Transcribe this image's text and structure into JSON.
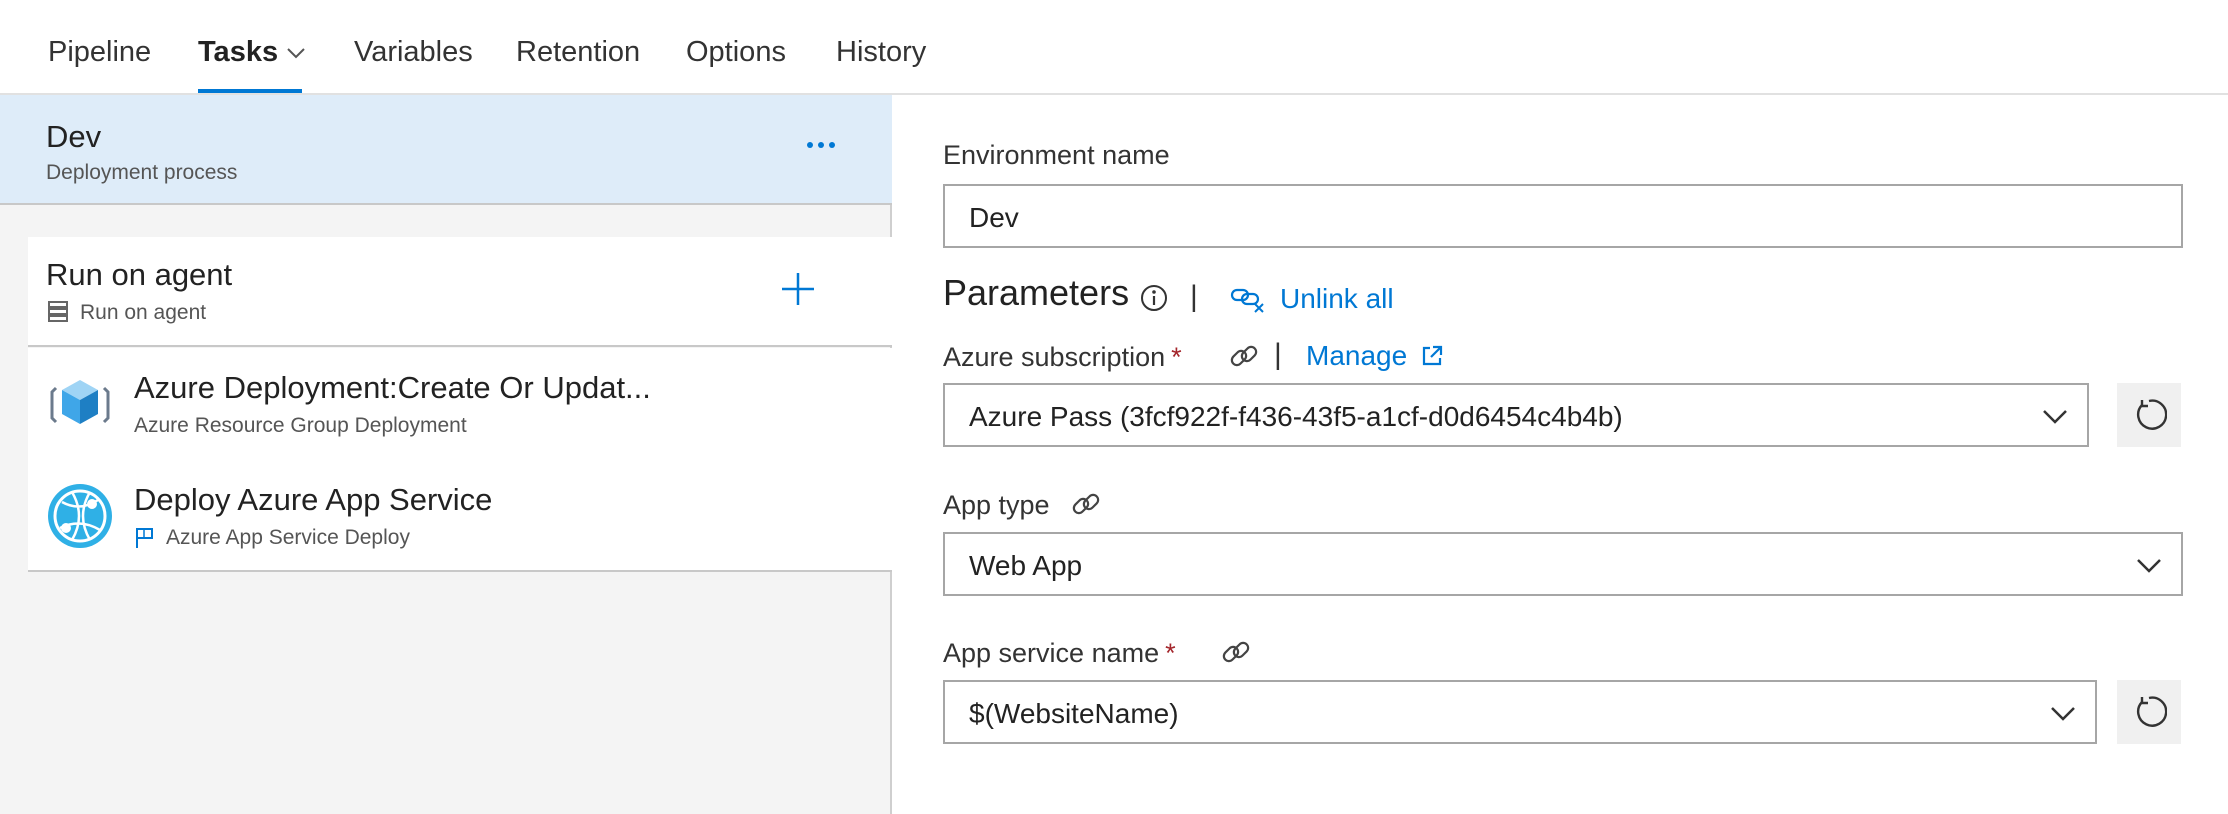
{
  "tabs": [
    {
      "label": "Pipeline",
      "active": false
    },
    {
      "label": "Tasks",
      "active": true
    },
    {
      "label": "Variables",
      "active": false
    },
    {
      "label": "Retention",
      "active": false
    },
    {
      "label": "Options",
      "active": false
    },
    {
      "label": "History",
      "active": false
    }
  ],
  "stage": {
    "title": "Dev",
    "subtitle": "Deployment process",
    "more_icon": "ellipsis-icon"
  },
  "phase": {
    "title": "Run on agent",
    "subtitle": "Run on agent",
    "add_icon": "plus-icon"
  },
  "tasks": [
    {
      "title": "Azure Deployment:Create Or Updat...",
      "subtitle": "Azure Resource Group Deployment",
      "icon": "resource-group-cube-icon"
    },
    {
      "title": "Deploy Azure App Service",
      "subtitle": "Azure App Service Deploy",
      "icon": "app-service-globe-icon"
    }
  ],
  "form": {
    "env_label": "Environment name",
    "env_value": "Dev",
    "params_title": "Parameters",
    "separator": "|",
    "unlink_all": "Unlink all",
    "subscription": {
      "label": "Azure subscription",
      "required_mark": "*",
      "value": "Azure Pass (3fcf922f-f436-43f5-a1cf-d0d6454c4b4b)",
      "manage": "Manage"
    },
    "app_type": {
      "label": "App type",
      "value": "Web App"
    },
    "app_service": {
      "label": "App service name",
      "required_mark": "*",
      "value": "$(WebsiteName)"
    }
  },
  "colors": {
    "accent": "#0078d4",
    "selected_bg": "#deecf9",
    "required": "#a4262c"
  }
}
